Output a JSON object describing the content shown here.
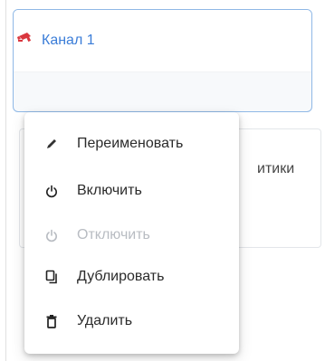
{
  "channel": {
    "title": "Канал 1",
    "icon": "camera-icon",
    "accent_color": "#d9363e"
  },
  "background_card": {
    "partial_text": "итики"
  },
  "context_menu": {
    "items": [
      {
        "label": "Переименовать",
        "icon": "pencil-icon",
        "disabled": false
      },
      {
        "label": "Включить",
        "icon": "power-icon",
        "disabled": false
      },
      {
        "label": "Отключить",
        "icon": "power-icon",
        "disabled": true
      },
      {
        "label": "Дублировать",
        "icon": "copy-icon",
        "disabled": false
      },
      {
        "label": "Удалить",
        "icon": "trash-icon",
        "disabled": false
      }
    ]
  }
}
